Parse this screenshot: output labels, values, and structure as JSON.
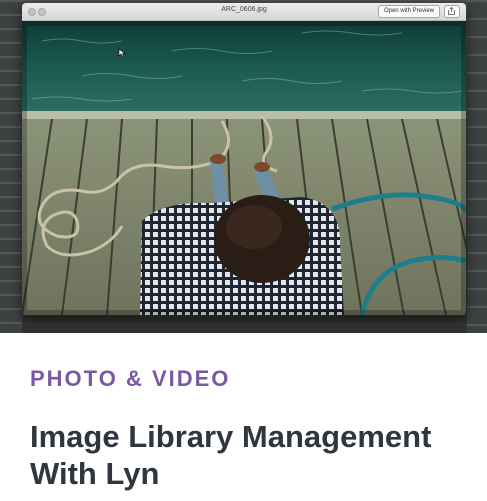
{
  "preview_window": {
    "filename": "ARC_0606.jpg",
    "open_button_label": "Open with Preview",
    "share_icon": "share-icon"
  },
  "card": {
    "category": "PHOTO & VIDEO",
    "title": "Image Library Management With Lyn"
  },
  "colors": {
    "category": "#7a58a3",
    "title": "#2f3640",
    "background": "#ffffff"
  }
}
